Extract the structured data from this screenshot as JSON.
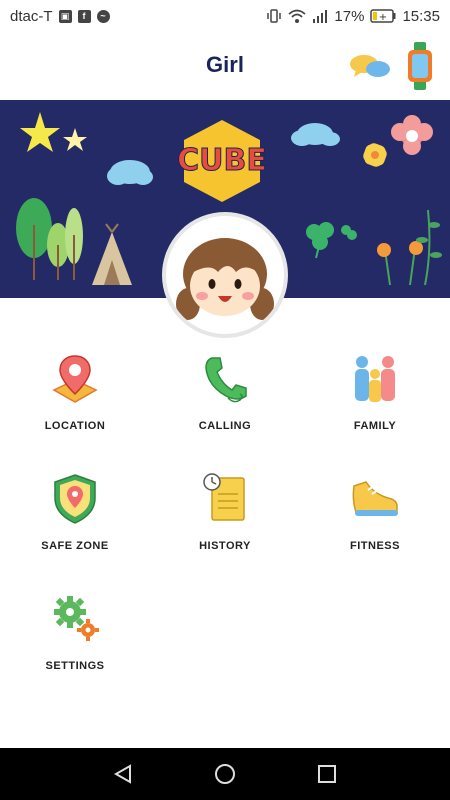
{
  "status_bar": {
    "carrier": "dtac-T",
    "battery": "17%",
    "time": "15:35",
    "icons": [
      "gallery-icon",
      "facebook-icon",
      "messenger-icon",
      "vibrate-icon",
      "wifi-icon",
      "signal-icon",
      "battery-icon"
    ]
  },
  "header": {
    "title": "Girl",
    "chat_icon": "chat-bubbles-icon",
    "watch_icon": "smartwatch-icon"
  },
  "banner": {
    "logo_text": "CUBE",
    "logo_colors": [
      "#e74c3c",
      "#2ecc71",
      "#f39c12",
      "#e84393"
    ],
    "background": "#232a66"
  },
  "menu": {
    "items": [
      {
        "label": "LOCATION",
        "icon": "map-pin-icon"
      },
      {
        "label": "CALLING",
        "icon": "phone-icon"
      },
      {
        "label": "FAMILY",
        "icon": "family-icon"
      },
      {
        "label": "SAFE ZONE",
        "icon": "shield-pin-icon"
      },
      {
        "label": "HISTORY",
        "icon": "clipboard-clock-icon"
      },
      {
        "label": "FITNESS",
        "icon": "sneaker-icon"
      },
      {
        "label": "SETTINGS",
        "icon": "gears-icon"
      }
    ]
  },
  "nav": {
    "back": "back-icon",
    "home": "home-icon",
    "recents": "recents-icon"
  }
}
